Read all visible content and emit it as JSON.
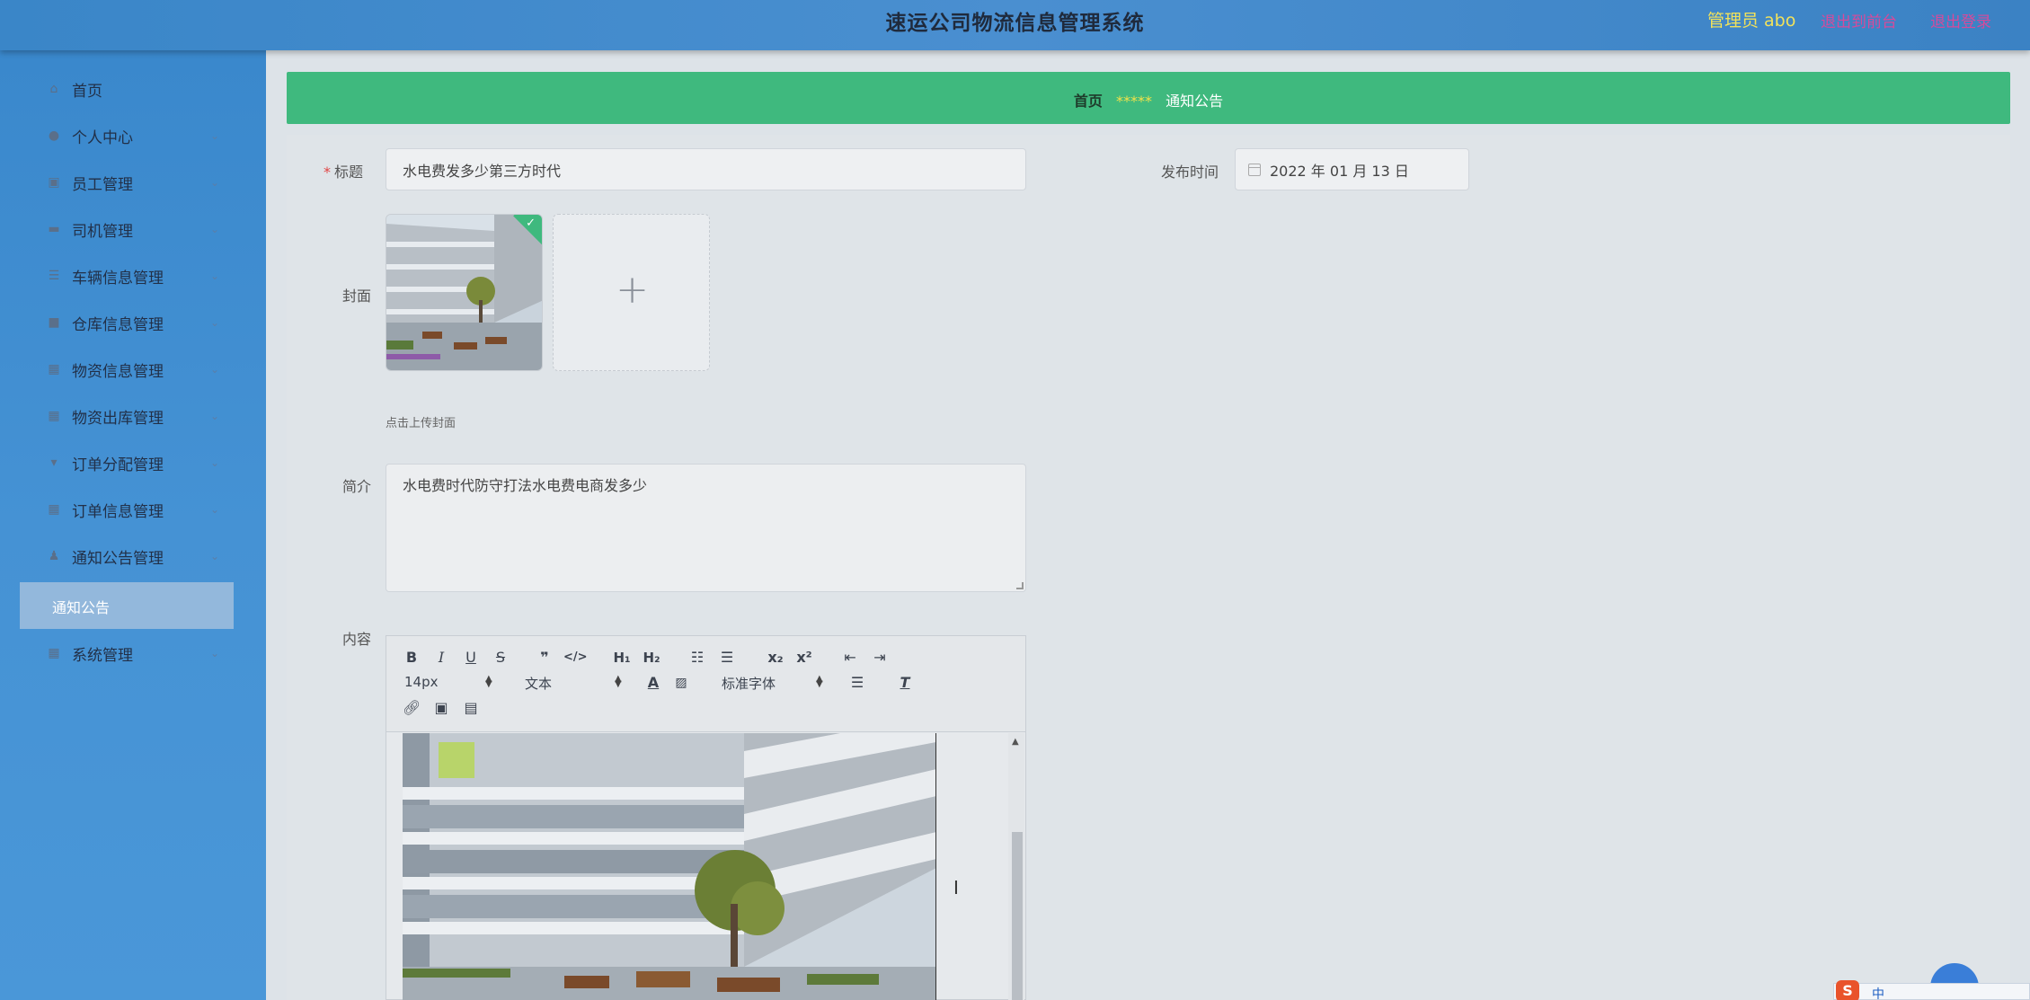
{
  "header": {
    "title": "速运公司物流信息管理系统",
    "user": "管理员 abo",
    "front_link": "退出到前台",
    "logout_link": "退出登录"
  },
  "sidebar": {
    "items": [
      {
        "label": "首页",
        "icon": "home-icon",
        "expandable": false
      },
      {
        "label": "个人中心",
        "icon": "user-icon",
        "expandable": true
      },
      {
        "label": "员工管理",
        "icon": "card-icon",
        "expandable": true
      },
      {
        "label": "司机管理",
        "icon": "briefcase-icon",
        "expandable": true
      },
      {
        "label": "车辆信息管理",
        "icon": "list-icon",
        "expandable": true
      },
      {
        "label": "仓库信息管理",
        "icon": "box-icon",
        "expandable": true
      },
      {
        "label": "物资信息管理",
        "icon": "grid-icon",
        "expandable": true
      },
      {
        "label": "物资出库管理",
        "icon": "grid-icon",
        "expandable": true
      },
      {
        "label": "订单分配管理",
        "icon": "cup-icon",
        "expandable": true
      },
      {
        "label": "订单信息管理",
        "icon": "grid-icon",
        "expandable": true
      },
      {
        "label": "通知公告管理",
        "icon": "person-icon",
        "expandable": true
      },
      {
        "label": "系统管理",
        "icon": "grid-icon",
        "expandable": true
      }
    ],
    "active_sub": "通知公告"
  },
  "breadcrumb": {
    "home": "首页",
    "separator": "*****",
    "current": "通知公告"
  },
  "form": {
    "title_label": "标题",
    "title_value": "水电费发多少第三方时代",
    "publish_label": "发布时间",
    "publish_value": "2022 年 01 月 13 日",
    "cover_label": "封面",
    "cover_hint": "点击上传封面",
    "summary_label": "简介",
    "summary_value": "水电费时代防守打法水电费电商发多少",
    "content_label": "内容"
  },
  "editor": {
    "font_size": "14px",
    "paragraph": "文本",
    "font_family": "标准字体"
  },
  "colors": {
    "accent_green": "#3fb97e",
    "header_blue": "#3a86c8",
    "link_pink": "#d74a9b",
    "user_yellow": "#f2e25a"
  },
  "overlay": {
    "ime_char": "中"
  }
}
